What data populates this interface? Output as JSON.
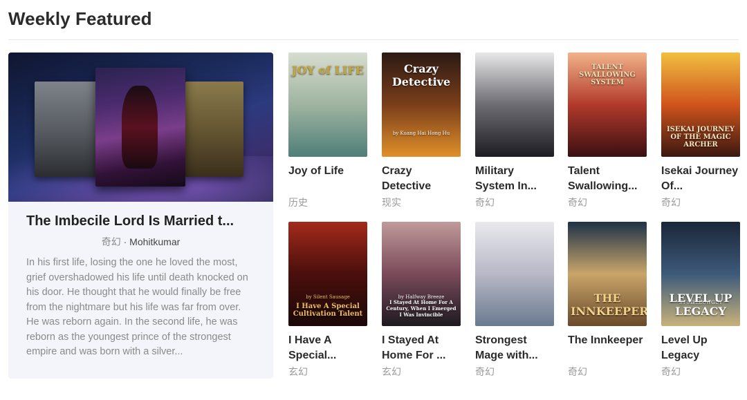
{
  "section": {
    "title": "Weekly Featured"
  },
  "featured": {
    "title": "The Imbecile Lord Is Married t...",
    "genre": "奇幻",
    "separator": " · ",
    "author": "Mohitkumar",
    "description": "In his first life, losing the one he loved the most, grief overshadowed his life until death knocked on his door.  He thought that he would finally be free from the nightmare but his life was far from over.  He was reborn again.  In the second life, he was reborn as the youngest prince of the strongest empire and was born with a silver..."
  },
  "books": [
    {
      "title": "Joy of Life",
      "genre": "历史",
      "cover_text": "JOY of LIFE",
      "cover_sub": "",
      "cover_colors": [
        "#d7ddd0",
        "#9fb4a0",
        "#4f7e79"
      ],
      "text_color": "#c7a53b"
    },
    {
      "title": "Crazy Detective",
      "genre": "现实",
      "cover_text": "Crazy Detective",
      "cover_sub": "by Kuang Hai Hong Hu",
      "cover_colors": [
        "#2c1a14",
        "#7a3e1a",
        "#e0902a"
      ],
      "text_color": "#ffffff"
    },
    {
      "title": "Military System In...",
      "genre": "奇幻",
      "cover_text": "",
      "cover_sub": "",
      "cover_colors": [
        "#e8e8ea",
        "#6c6c72",
        "#1c1c22"
      ],
      "text_color": "#ffffff"
    },
    {
      "title": "Talent Swallowing...",
      "genre": "奇幻",
      "cover_text": "TALENT SWALLOWING SYSTEM",
      "cover_sub": "",
      "cover_colors": [
        "#f2b38a",
        "#b23a2a",
        "#3a0f12"
      ],
      "text_color": "#f3e0b0"
    },
    {
      "title": "Isekai Journey Of...",
      "genre": "奇幻",
      "cover_text": "ISEKAI JOURNEY OF THE MAGIC ARCHER",
      "cover_sub": "",
      "cover_colors": [
        "#f0c040",
        "#d0541c",
        "#3a1810"
      ],
      "text_color": "#f7e4c0"
    },
    {
      "title": "I Have A Special...",
      "genre": "玄幻",
      "cover_text": "I Have A Special Cultivation Talent",
      "cover_sub": "by Silent Sausage",
      "cover_colors": [
        "#a22a1a",
        "#4a0f0c",
        "#1a0808"
      ],
      "text_color": "#f0c060"
    },
    {
      "title": "I Stayed At Home For ...",
      "genre": "玄幻",
      "cover_text": "I Stayed At Home For A Century, When I Emerged I Was Invincible",
      "cover_sub": "by Halfway Breeze",
      "cover_colors": [
        "#c09a9a",
        "#7a4a5a",
        "#1e1a20"
      ],
      "text_color": "#ffffff"
    },
    {
      "title": "Strongest Mage with...",
      "genre": "奇幻",
      "cover_text": "",
      "cover_sub": "",
      "cover_colors": [
        "#e9e9ee",
        "#b8b8c6",
        "#6a7a90"
      ],
      "text_color": "#ffffff"
    },
    {
      "title": "The Innkeeper",
      "genre": "奇幻",
      "cover_text": "THE INNKEEPER",
      "cover_sub": "",
      "cover_colors": [
        "#1e3248",
        "#c9a56a",
        "#6a4a2a"
      ],
      "text_color": "#f3d28a"
    },
    {
      "title": "Level Up Legacy",
      "genre": "奇幻",
      "cover_text": "LEVEL UP LEGACY",
      "cover_sub": "BY MELLOWGUY",
      "cover_colors": [
        "#1a2638",
        "#3d5a7a",
        "#c9b27a"
      ],
      "text_color": "#ffffff"
    }
  ]
}
